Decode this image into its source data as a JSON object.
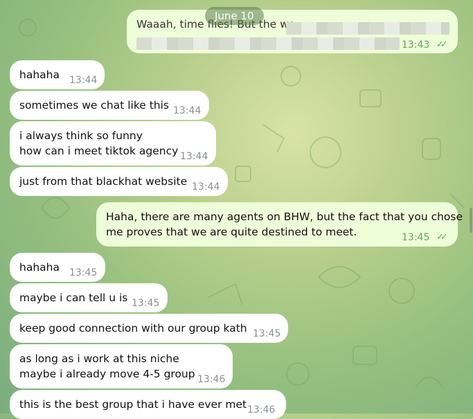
{
  "date_separator": "June 10",
  "outgoing_top": {
    "visible_text": "Waaah, time flies! But the wo",
    "time": "13:43",
    "status": "read"
  },
  "messages": [
    {
      "text": "hahaha",
      "time": "13:44"
    },
    {
      "text": "sometimes we chat like this",
      "time": "13:44"
    },
    {
      "line1": "i always think so funny",
      "line2": "how can i meet tiktok agency",
      "time": "13:44"
    },
    {
      "text": "just from that blackhat website",
      "time": "13:44"
    },
    {
      "line1": "Haha, there are many agents on BHW, but the fact that you chose",
      "line2": "me proves that we are quite destined to meet.",
      "time": "13:45",
      "status": "read"
    },
    {
      "text": "hahaha",
      "time": "13:45"
    },
    {
      "text": "maybe i can tell u is",
      "time": "13:45"
    },
    {
      "text": "keep good connection with our group kath",
      "time": "13:45"
    },
    {
      "line1": "as long as i work at this niche",
      "line2": "maybe i already move 4-5 group",
      "time": "13:46"
    },
    {
      "text": "this is the best group that i have ever met",
      "time": "13:46"
    }
  ],
  "colors": {
    "incoming": "#ffffff",
    "outgoing": "#eefed9",
    "read_ticks": "#4fae4e"
  },
  "icons": {
    "read_status": "double-check-icon"
  }
}
